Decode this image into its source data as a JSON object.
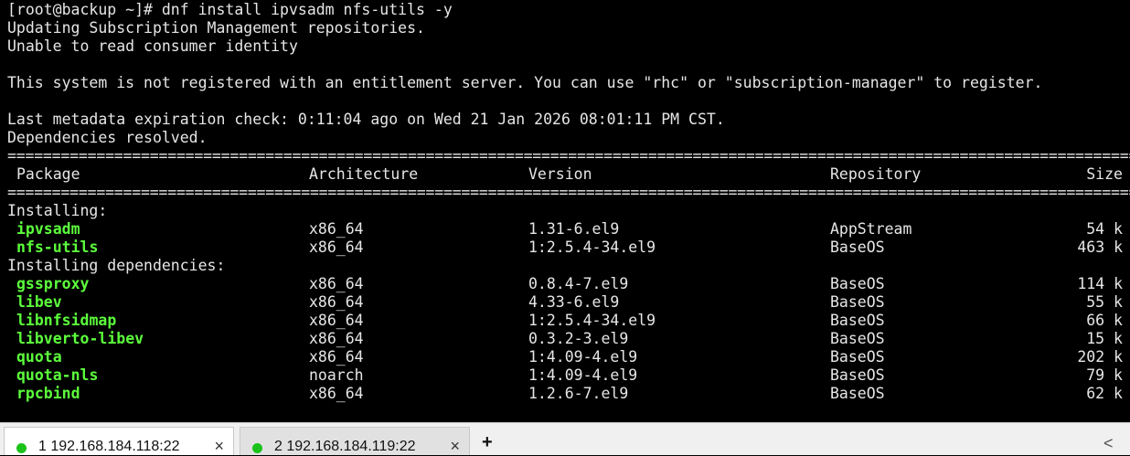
{
  "terminal": {
    "lines": [
      "[root@backup ~]# dnf install ipvsadm nfs-utils -y",
      "Updating Subscription Management repositories.",
      "Unable to read consumer identity",
      "",
      "This system is not registered with an entitlement server. You can use \"rhc\" or \"subscription-manager\" to register.",
      "",
      "Last metadata expiration check: 0:11:04 ago on Wed 21 Jan 2026 08:01:11 PM CST.",
      "Dependencies resolved."
    ],
    "separator": "================================================================================================================================================",
    "headers": {
      "package": "Package",
      "architecture": "Architecture",
      "version": "Version",
      "repository": "Repository",
      "size": "Size"
    },
    "section_installing": "Installing:",
    "section_dependencies": "Installing dependencies:",
    "installing": [
      {
        "name": "ipvsadm",
        "arch": "x86_64",
        "version": "1.31-6.el9",
        "repo": "AppStream",
        "size": "54 k"
      },
      {
        "name": "nfs-utils",
        "arch": "x86_64",
        "version": "1:2.5.4-34.el9",
        "repo": "BaseOS",
        "size": "463 k"
      }
    ],
    "dependencies": [
      {
        "name": "gssproxy",
        "arch": "x86_64",
        "version": "0.8.4-7.el9",
        "repo": "BaseOS",
        "size": "114 k"
      },
      {
        "name": "libev",
        "arch": "x86_64",
        "version": "4.33-6.el9",
        "repo": "BaseOS",
        "size": "55 k"
      },
      {
        "name": "libnfsidmap",
        "arch": "x86_64",
        "version": "1:2.5.4-34.el9",
        "repo": "BaseOS",
        "size": "66 k"
      },
      {
        "name": "libverto-libev",
        "arch": "x86_64",
        "version": "0.3.2-3.el9",
        "repo": "BaseOS",
        "size": "15 k"
      },
      {
        "name": "quota",
        "arch": "x86_64",
        "version": "1:4.09-4.el9",
        "repo": "BaseOS",
        "size": "202 k"
      },
      {
        "name": "quota-nls",
        "arch": "noarch",
        "version": "1:4.09-4.el9",
        "repo": "BaseOS",
        "size": "79 k"
      },
      {
        "name": "rpcbind",
        "arch": "x86_64",
        "version": "1.2.6-7.el9",
        "repo": "BaseOS",
        "size": "62 k"
      }
    ]
  },
  "tabs": [
    {
      "label": "1 192.168.184.118:22",
      "close": "×",
      "status_color": "#1cc21c"
    },
    {
      "label": "2 192.168.184.119:22",
      "close": "×",
      "status_color": "#1cc21c"
    }
  ],
  "tabbar": {
    "new_tab": "+",
    "scroll_left": "<"
  }
}
